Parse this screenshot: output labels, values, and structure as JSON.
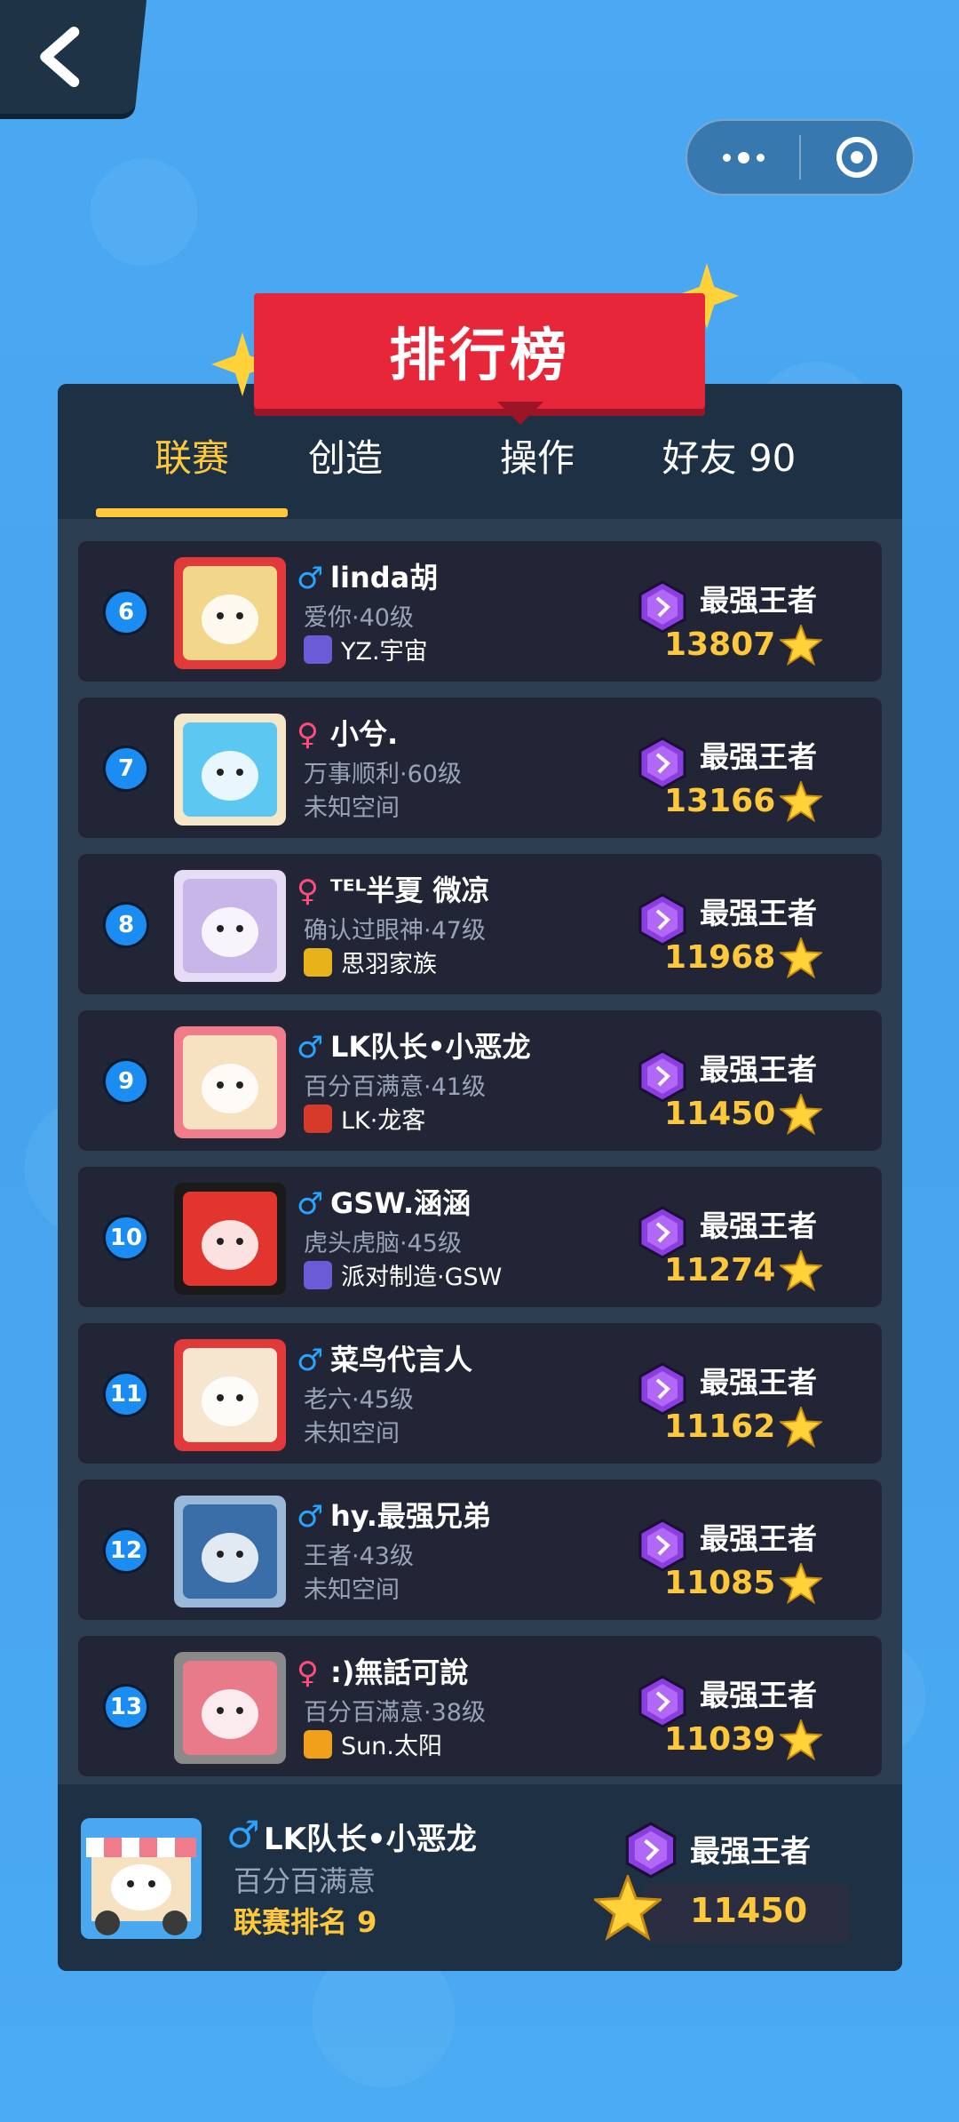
{
  "header": {
    "title": "排行榜"
  },
  "tabs": [
    {
      "label": "联赛",
      "active": true
    },
    {
      "label": "创造",
      "active": false
    },
    {
      "label": "操作",
      "active": false
    },
    {
      "label": "好友 90",
      "active": false
    }
  ],
  "colors": {
    "accent": "#ffc83a",
    "banner": "#e8263a",
    "rank_badge": "#1b8df2",
    "male": "#2aa2ff",
    "female": "#ff4d7a"
  },
  "leaderboard": [
    {
      "rank": "6",
      "gender": "♂",
      "gender_type": "male",
      "name": "linda胡",
      "sub": "爱你·40级",
      "clan": "YZ.宇宙",
      "clan_color": "#6b5bd6",
      "tier": "最强王者",
      "score": "13807"
    },
    {
      "rank": "7",
      "gender": "♀",
      "gender_type": "female",
      "name": "小兮.",
      "sub": "万事顺利·60级",
      "clan": "未知空间",
      "clan_color": "",
      "tier": "最强王者",
      "score": "13166"
    },
    {
      "rank": "8",
      "gender": "♀",
      "gender_type": "female",
      "name": "ᵀᴱᴸ半夏 微凉",
      "sub": "确认过眼神·47级",
      "clan": "思羽家族",
      "clan_color": "#e8b21a",
      "tier": "最强王者",
      "score": "11968"
    },
    {
      "rank": "9",
      "gender": "♂",
      "gender_type": "male",
      "name": "LK队长•小恶龙",
      "sub": "百分百满意·41级",
      "clan": "LK·龙客",
      "clan_color": "#d83a2a",
      "tier": "最强王者",
      "score": "11450"
    },
    {
      "rank": "10",
      "gender": "♂",
      "gender_type": "male",
      "name": "GSW.涵涵",
      "sub": "虎头虎脑·45级",
      "clan": "派对制造·GSW",
      "clan_color": "#6b5bd6",
      "tier": "最强王者",
      "score": "11274"
    },
    {
      "rank": "11",
      "gender": "♂",
      "gender_type": "male",
      "name": "菜鸟代言人",
      "sub": "老六·45级",
      "clan": "未知空间",
      "clan_color": "",
      "tier": "最强王者",
      "score": "11162"
    },
    {
      "rank": "12",
      "gender": "♂",
      "gender_type": "male",
      "name": "hy.最强兄弟",
      "sub": "王者·43级",
      "clan": "未知空间",
      "clan_color": "",
      "tier": "最强王者",
      "score": "11085"
    },
    {
      "rank": "13",
      "gender": "♀",
      "gender_type": "female",
      "name": ":)無話可說",
      "sub": "百分百滿意·38级",
      "clan": "Sun.太阳",
      "clan_color": "#f0a01a",
      "tier": "最强王者",
      "score": "11039"
    }
  ],
  "me": {
    "gender": "♂",
    "name": "LK队长•小恶龙",
    "sub": "百分百满意",
    "rank_label": "联赛排名 9",
    "tier": "最强王者",
    "score": "11450"
  }
}
